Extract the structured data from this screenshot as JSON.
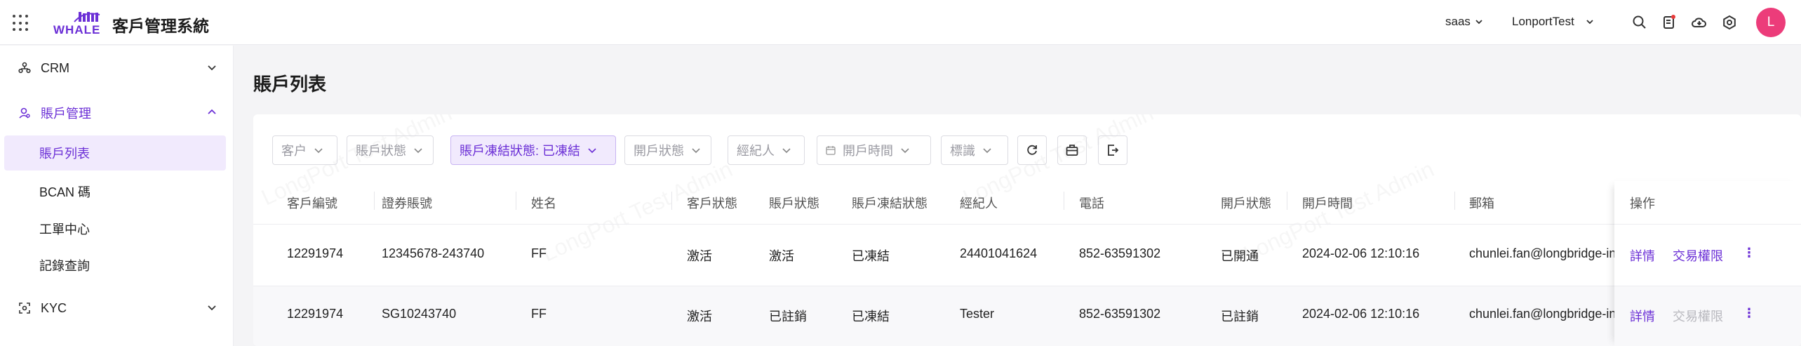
{
  "header": {
    "logo_top": "LONGBRIDGE",
    "logo_text": "WHALE",
    "app_title": "客戶管理系統",
    "env_select": "saas",
    "org_select": "LonportTest",
    "avatar_letter": "L",
    "accent_color": "#6b2fd6",
    "avatar_color": "#ec3c7a"
  },
  "sidebar": {
    "groups": [
      {
        "label": "CRM",
        "icon": "crm-org-icon"
      },
      {
        "label": "賬戶管理",
        "icon": "user-account-icon"
      },
      {
        "label": "KYC",
        "icon": "scan-icon"
      }
    ],
    "items": [
      {
        "label": "賬戶列表"
      },
      {
        "label": "BCAN 碼"
      },
      {
        "label": "工單中心"
      },
      {
        "label": "記錄查詢"
      }
    ]
  },
  "page": {
    "title": "賬戶列表",
    "watermark": "LongPort Test Admin"
  },
  "filters": {
    "customer": "客户",
    "account_status": "賬戶狀態",
    "freeze_status": "賬戶凍結狀態: 已凍結",
    "open_status": "開戶狀態",
    "broker": "經紀人",
    "open_time": "開戶時間",
    "tag": "標識"
  },
  "table": {
    "headers": {
      "customer_id": "客戶編號",
      "securities_account": "證券賬號",
      "name": "姓名",
      "customer_status": "客戶狀態",
      "account_status": "賬戶狀態",
      "freeze_status": "賬戶凍結狀態",
      "broker": "經紀人",
      "phone": "電話",
      "open_status": "開戶狀態",
      "open_time": "開戶時間",
      "email": "郵箱",
      "actions": "操作"
    },
    "rows": [
      {
        "customer_id": "12291974",
        "securities_account": "12345678-243740",
        "name": "FF",
        "customer_status": "激活",
        "account_status": "激活",
        "freeze_status": "已凍結",
        "broker": "24401041624",
        "phone": "852-63591302",
        "open_status": "已開通",
        "open_time": "2024-02-06 12:10:16",
        "email": "chunlei.fan@longbridge-inc.com",
        "action_detail": "詳情",
        "action_trade": "交易權限",
        "action_more": "⋮"
      },
      {
        "customer_id": "12291974",
        "securities_account": "SG10243740",
        "name": "FF",
        "customer_status": "激活",
        "account_status": "已註銷",
        "freeze_status": "已凍結",
        "broker": "Tester",
        "phone": "852-63591302",
        "open_status": "已註銷",
        "open_time": "2024-02-06 12:10:16",
        "email": "chunlei.fan@longbridge-inc.com",
        "action_detail": "詳情",
        "action_trade": "交易權限",
        "action_more": "⋮"
      }
    ]
  }
}
